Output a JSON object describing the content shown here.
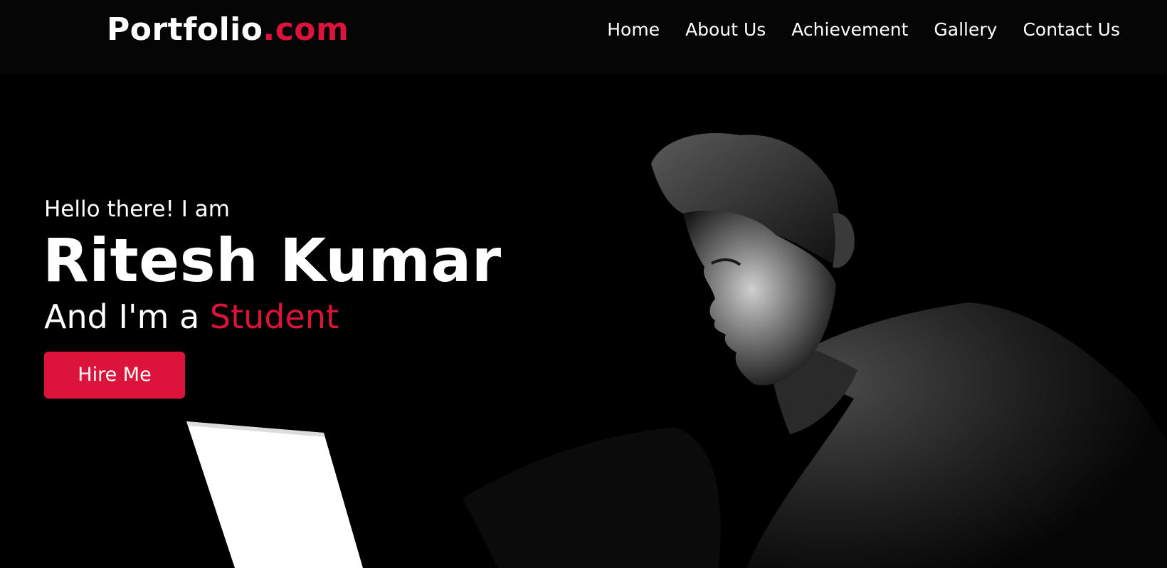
{
  "navbar": {
    "logo_main": "Portfolio",
    "logo_accent": ".com",
    "menu": [
      {
        "label": "Home"
      },
      {
        "label": "About Us"
      },
      {
        "label": "Achievement"
      },
      {
        "label": "Gallery"
      },
      {
        "label": "Contact Us"
      }
    ]
  },
  "hero": {
    "greeting": "Hello there! I am",
    "name": "Ritesh Kumar",
    "role_prefix": "And I'm a ",
    "role_accent": "Student",
    "cta_label": "Hire Me",
    "background_image": "person-at-laptop-in-dark-photo"
  },
  "colors": {
    "accent": "#dc143c",
    "background": "#000000",
    "text": "#ffffff"
  }
}
